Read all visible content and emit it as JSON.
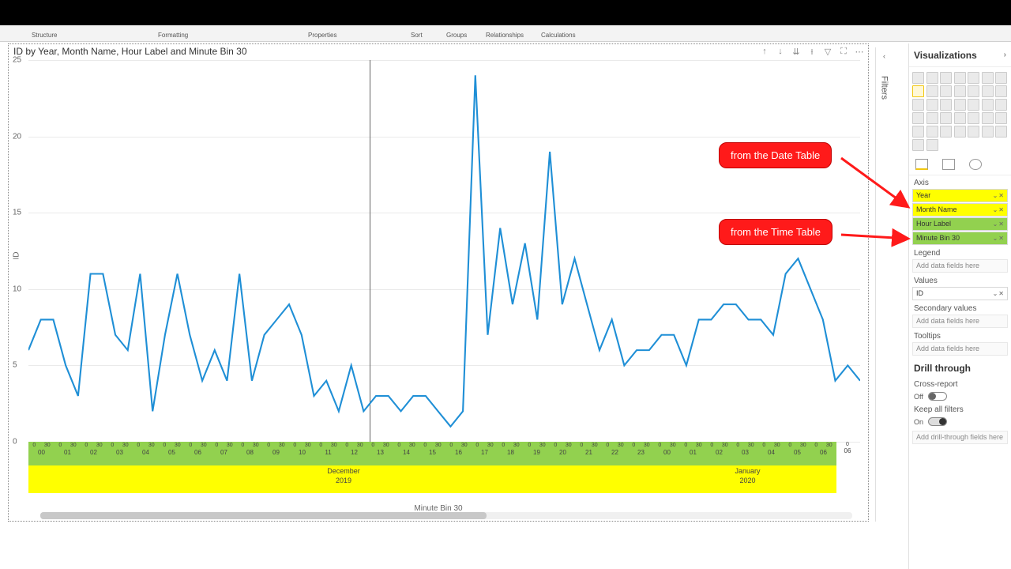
{
  "ribbon": {
    "groups": [
      "Structure",
      "Formatting",
      "Properties",
      "Sort",
      "Groups",
      "Relationships",
      "Calculations"
    ]
  },
  "chart": {
    "title": "ID by Year, Month Name, Hour Label and Minute Bin 30",
    "ylabel": "ID",
    "xlabel": "Minute Bin 30",
    "yticks": [
      0,
      5,
      10,
      15,
      20,
      25
    ],
    "hours_dec": [
      "00",
      "01",
      "02",
      "03",
      "04",
      "05",
      "06",
      "07",
      "08",
      "09",
      "10",
      "11",
      "12",
      "13",
      "14",
      "15",
      "16",
      "17",
      "18",
      "19",
      "20",
      "21",
      "22",
      "23"
    ],
    "hours_jan": [
      "00",
      "01",
      "02",
      "03",
      "04",
      "05",
      "06"
    ],
    "months": [
      {
        "label": "December",
        "year": "2019"
      },
      {
        "label": "January",
        "year": "2020"
      }
    ],
    "header_icons": [
      "drill-up",
      "drill-next",
      "expand-all",
      "drill-toggle",
      "filter",
      "focus",
      "more"
    ]
  },
  "chart_data": {
    "type": "line",
    "title": "ID by Year, Month Name, Hour Label and Minute Bin 30",
    "xlabel": "Minute Bin 30",
    "ylabel": "ID",
    "ylim": [
      0,
      25
    ],
    "x_hierarchy": [
      "Year",
      "Month Name",
      "Hour Label",
      "Minute Bin 30"
    ],
    "series": [
      {
        "name": "ID",
        "values": [
          6,
          8,
          8,
          5,
          3,
          11,
          11,
          7,
          6,
          11,
          2,
          7,
          11,
          7,
          4,
          6,
          4,
          11,
          4,
          7,
          8,
          9,
          7,
          3,
          4,
          2,
          5,
          2,
          3,
          3,
          2,
          3,
          3,
          2,
          1,
          2,
          24,
          7,
          14,
          9,
          13,
          8,
          19,
          9,
          12,
          9,
          6,
          8,
          5,
          6,
          6,
          7,
          7,
          5,
          8,
          8,
          9,
          9,
          8,
          8,
          7,
          11,
          12,
          10,
          8,
          4,
          5,
          4
        ]
      }
    ],
    "x_categories_level3": [
      "00",
      "01",
      "02",
      "03",
      "04",
      "05",
      "06",
      "07",
      "08",
      "09",
      "10",
      "11",
      "12",
      "13",
      "14",
      "15",
      "16",
      "17",
      "18",
      "19",
      "20",
      "21",
      "22",
      "23",
      "00",
      "01",
      "02",
      "03",
      "04",
      "05",
      "06"
    ],
    "x_bins": [
      "0",
      "30"
    ],
    "x_categories_level2": [
      "December",
      "January"
    ],
    "x_categories_level1": [
      "2019",
      "2020"
    ]
  },
  "filters": {
    "label": "Filters"
  },
  "vis": {
    "title": "Visualizations",
    "tabs": [
      "fields",
      "format",
      "analytics"
    ],
    "sections": {
      "axis": "Axis",
      "legend": "Legend",
      "values": "Values",
      "secondary": "Secondary values",
      "tooltips": "Tooltips",
      "drill": "Drill through",
      "cross": "Cross-report",
      "keep": "Keep all filters"
    },
    "axis_fields": [
      {
        "label": "Year",
        "cls": "yel"
      },
      {
        "label": "Month Name",
        "cls": "yel"
      },
      {
        "label": "Hour Label",
        "cls": "grn"
      },
      {
        "label": "Minute Bin 30",
        "cls": "grn"
      }
    ],
    "values_fields": [
      {
        "label": "ID",
        "cls": ""
      }
    ],
    "placeholder": "Add data fields here",
    "drill_placeholder": "Add drill-through fields here",
    "off": "Off",
    "on": "On"
  },
  "callouts": {
    "date": "from the Date Table",
    "time": "from the Time Table"
  }
}
